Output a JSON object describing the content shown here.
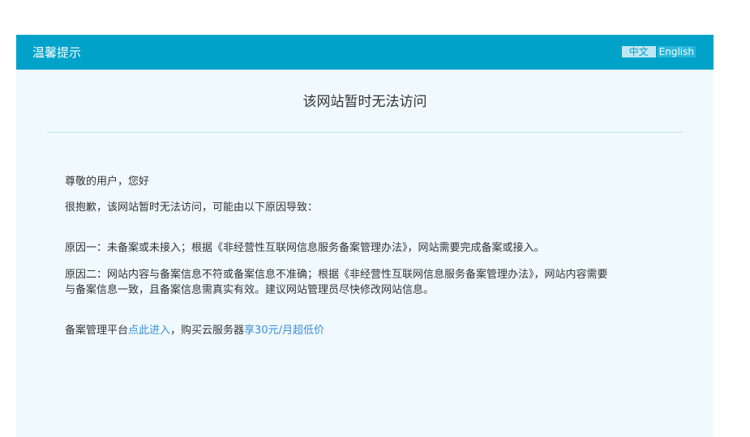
{
  "header": {
    "title": "温馨提示",
    "lang_zh": "中文",
    "lang_en": "English"
  },
  "main": {
    "title": "该网站暂时无法访问",
    "greeting": "尊敬的用户，您好",
    "intro": "很抱歉，该网站暂时无法访问，可能由以下原因导致：",
    "reason_one": "原因一：未备案或未接入；根据《非经营性互联网信息服务备案管理办法》，网站需要完成备案或接入。",
    "reason_two_line1": "原因二：网站内容与备案信息不符或备案信息不准确；根据《非经营性互联网信息服务备案管理办法》，网站内容需要",
    "reason_two_line2": "与备案信息一致，且备案信息需真实有效。建议网站管理员尽快修改网站信息。",
    "footer_prefix": "备案管理平台",
    "footer_link1": "点此进入",
    "footer_middle": "，购买云服务器",
    "footer_link2": "享30元/月超低价"
  },
  "colors": {
    "header_bg": "#00a2ca",
    "panel_bg": "#f0f9fe",
    "link": "#3b8ed9",
    "text": "#333333"
  }
}
